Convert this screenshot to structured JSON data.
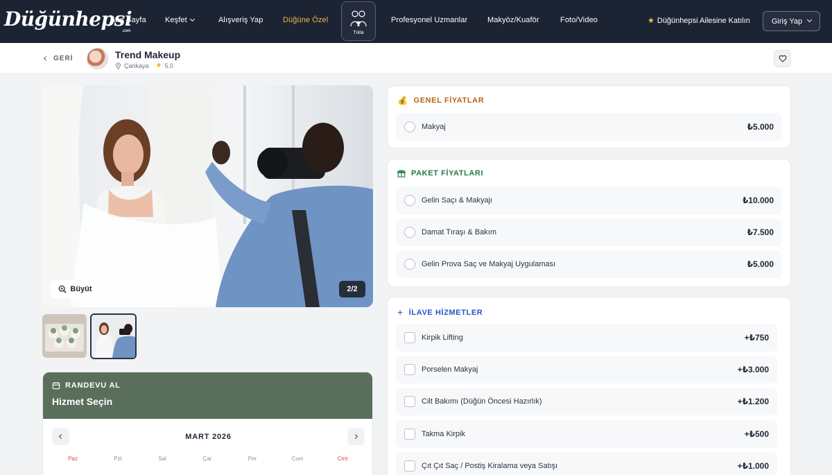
{
  "nav": {
    "logo": "Düğünhepsi",
    "logo_sub": ".com",
    "items": [
      "Ana Sayfa",
      "Keşfet",
      "Alışveriş Yap",
      "Düğüne Özel"
    ],
    "tikla": "Tıkla",
    "items2": [
      "Profesyonel Uzmanlar",
      "Makyöz/Kuaför",
      "Foto/Video"
    ],
    "join": "Düğünhepsi Ailesine Katılın",
    "login": "Giriş Yap"
  },
  "subheader": {
    "back": "GERİ",
    "vendor_name": "Trend Makeup",
    "location": "Çankaya",
    "rating": "5.0"
  },
  "gallery": {
    "zoom_label": "Büyüt",
    "counter": "2/2"
  },
  "booking": {
    "caption": "RANDEVU AL",
    "title": "Hizmet Seçin",
    "month": "MART 2026",
    "days": [
      "Paz",
      "Pzt",
      "Sal",
      "Çar",
      "Per",
      "Cum",
      "Cmt"
    ]
  },
  "general": {
    "title": "GENEL FİYATLAR",
    "items": [
      {
        "label": "Makyaj",
        "price": "₺5.000"
      }
    ]
  },
  "packages": {
    "title": "PAKET FİYATLARI",
    "items": [
      {
        "label": "Gelin Saçı & Makyajı",
        "price": "₺10.000"
      },
      {
        "label": "Damat Tıraşı & Bakım",
        "price": "₺7.500"
      },
      {
        "label": "Gelin Prova Saç ve Makyaj Uygulaması",
        "price": "₺5.000"
      }
    ]
  },
  "extras": {
    "title": "İLAVE HİZMETLER",
    "items": [
      {
        "label": "Kirpik Lifting",
        "price": "+₺750"
      },
      {
        "label": "Porselen Makyaj",
        "price": "+₺3.000"
      },
      {
        "label": "Cilt Bakımı (Düğün Öncesi Hazırlık)",
        "price": "+₺1.200"
      },
      {
        "label": "Takma Kirpik",
        "price": "+₺500"
      },
      {
        "label": "Çıt Çıt Saç / Postiş Kiralama veya Satışı",
        "price": "+₺1.000"
      }
    ]
  },
  "colors": {
    "nav_bg": "#1c2333",
    "gold": "#e8b84a",
    "general_title": "#b5651d",
    "package_title": "#1f7a4a",
    "extras_title": "#2456c8",
    "booking_head": "#5a6e5c"
  }
}
